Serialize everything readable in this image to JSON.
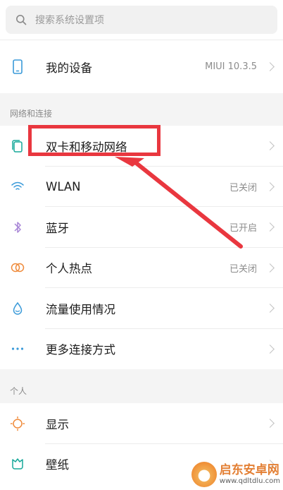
{
  "search": {
    "placeholder": "搜索系统设置项"
  },
  "device": {
    "label": "我的设备",
    "value": "MIUI 10.3.5"
  },
  "sections": {
    "network": {
      "title": "网络和连接",
      "items": [
        {
          "label": "双卡和移动网络",
          "value": ""
        },
        {
          "label": "WLAN",
          "value": "已关闭"
        },
        {
          "label": "蓝牙",
          "value": "已开启"
        },
        {
          "label": "个人热点",
          "value": "已关闭"
        },
        {
          "label": "流量使用情况",
          "value": ""
        },
        {
          "label": "更多连接方式",
          "value": ""
        }
      ]
    },
    "personal": {
      "title": "个人",
      "items": [
        {
          "label": "显示",
          "value": ""
        },
        {
          "label": "壁纸",
          "value": ""
        }
      ]
    }
  },
  "watermark": {
    "title": "启东安卓网",
    "url": "www.qdltdlu.com"
  },
  "colors": {
    "highlight": "#e9373f",
    "accent_blue": "#3a9ad9",
    "orange": "#ef8a3a",
    "teal": "#17a89a",
    "purple": "#a784d6"
  }
}
